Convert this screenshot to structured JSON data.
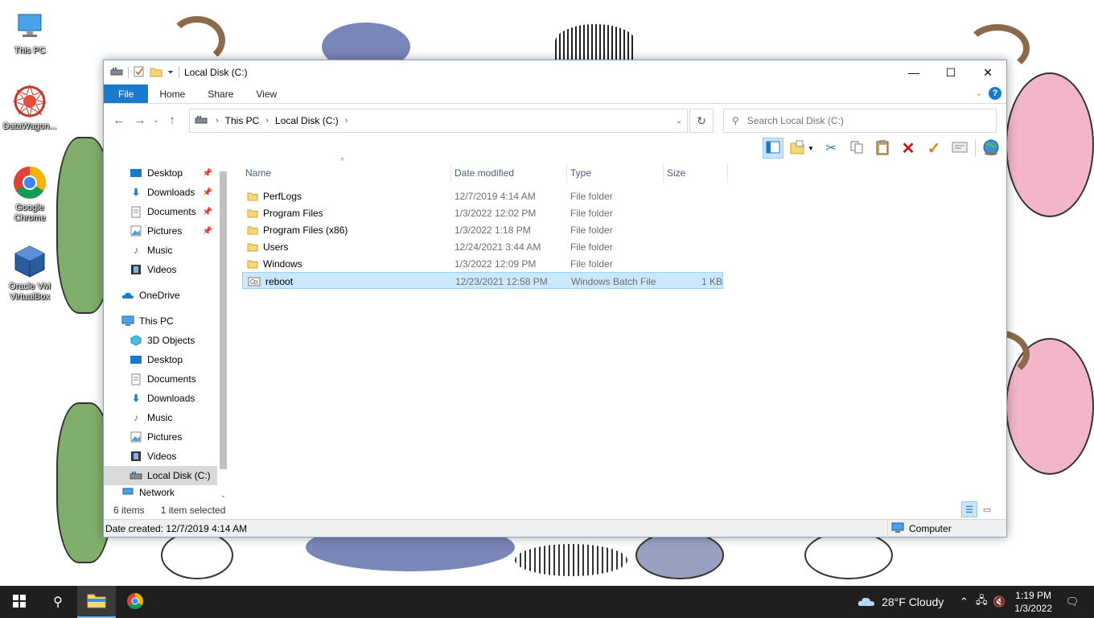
{
  "desktop": {
    "icons": [
      {
        "label": "This PC"
      },
      {
        "label": "DataWagon..."
      },
      {
        "label": "Google Chrome"
      },
      {
        "label": "Oracle VM VirtualBox"
      }
    ]
  },
  "window": {
    "title": "Local Disk (C:)",
    "controls": {
      "minimize": "—",
      "maximize": "☐",
      "close": "✕"
    }
  },
  "ribbon": {
    "tabs": [
      "File",
      "Home",
      "Share",
      "View"
    ],
    "help": "?"
  },
  "address": {
    "crumbs": [
      "This PC",
      "Local Disk (C:)"
    ],
    "search_placeholder": "Search Local Disk (C:)"
  },
  "nav": {
    "quick_access": [
      {
        "label": "Desktop",
        "icon": "desktop-icon",
        "pinned": true
      },
      {
        "label": "Downloads",
        "icon": "downloads-icon",
        "pinned": true
      },
      {
        "label": "Documents",
        "icon": "documents-icon",
        "pinned": true
      },
      {
        "label": "Pictures",
        "icon": "pictures-icon",
        "pinned": true
      },
      {
        "label": "Music",
        "icon": "music-icon",
        "pinned": false
      },
      {
        "label": "Videos",
        "icon": "videos-icon",
        "pinned": false
      }
    ],
    "onedrive": "OneDrive",
    "this_pc": "This PC",
    "this_pc_items": [
      {
        "label": "3D Objects",
        "icon": "3d-objects-icon"
      },
      {
        "label": "Desktop",
        "icon": "desktop-icon"
      },
      {
        "label": "Documents",
        "icon": "documents-icon"
      },
      {
        "label": "Downloads",
        "icon": "downloads-icon"
      },
      {
        "label": "Music",
        "icon": "music-icon"
      },
      {
        "label": "Pictures",
        "icon": "pictures-icon"
      },
      {
        "label": "Videos",
        "icon": "videos-icon"
      },
      {
        "label": "Local Disk (C:)",
        "icon": "drive-icon",
        "selected": true
      }
    ],
    "network": "Network"
  },
  "columns": {
    "name": "Name",
    "date": "Date modified",
    "type": "Type",
    "size": "Size"
  },
  "files": [
    {
      "name": "PerfLogs",
      "date": "12/7/2019 4:14 AM",
      "type": "File folder",
      "size": "",
      "icon": "folder-icon"
    },
    {
      "name": "Program Files",
      "date": "1/3/2022 12:02 PM",
      "type": "File folder",
      "size": "",
      "icon": "folder-icon"
    },
    {
      "name": "Program Files (x86)",
      "date": "1/3/2022 1:18 PM",
      "type": "File folder",
      "size": "",
      "icon": "folder-icon"
    },
    {
      "name": "Users",
      "date": "12/24/2021 3:44 AM",
      "type": "File folder",
      "size": "",
      "icon": "folder-icon"
    },
    {
      "name": "Windows",
      "date": "1/3/2022 12:09 PM",
      "type": "File folder",
      "size": "",
      "icon": "folder-icon"
    },
    {
      "name": "reboot",
      "date": "12/23/2021 12:58 PM",
      "type": "Windows Batch File",
      "size": "1 KB",
      "icon": "batch-file-icon",
      "selected": true
    }
  ],
  "status": {
    "items": "6 items",
    "selected": "1 item selected"
  },
  "details": {
    "date_created": "Date created: 12/7/2019 4:14 AM",
    "location": "Computer"
  },
  "taskbar": {
    "weather": "28°F  Cloudy",
    "time": "1:19 PM",
    "date": "1/3/2022"
  },
  "colors": {
    "accent": "#1979ca",
    "selection": "#cce8ff",
    "taskbar": "#1f1f1f",
    "folder": "#f8d775"
  }
}
